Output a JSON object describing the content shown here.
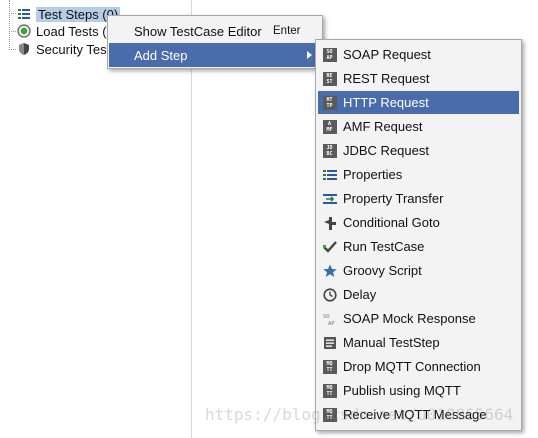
{
  "tree": {
    "items": [
      {
        "label": "Test Steps (0)",
        "icon": "list-icon",
        "selected": true
      },
      {
        "label": "Load Tests (",
        "icon": "gauge-icon",
        "selected": false
      },
      {
        "label": "Security Tes",
        "icon": "shield-icon",
        "selected": false
      }
    ]
  },
  "context_menu": {
    "items": [
      {
        "label": "Show TestCase Editor",
        "accelerator": "Enter"
      },
      {
        "label": "Add Step",
        "has_submenu": true
      }
    ]
  },
  "submenu": {
    "items": [
      {
        "label": "SOAP Request",
        "icon": "soap-request-icon",
        "tile": "SO AP"
      },
      {
        "label": "REST Request",
        "icon": "rest-request-icon",
        "tile": "RE ST"
      },
      {
        "label": "HTTP Request",
        "icon": "http-request-icon",
        "tile": "HT TP",
        "highlighted": true
      },
      {
        "label": "AMF Request",
        "icon": "amf-request-icon",
        "tile": "A MF"
      },
      {
        "label": "JDBC Request",
        "icon": "jdbc-request-icon",
        "tile": "JD BC"
      },
      {
        "label": "Properties",
        "icon": "properties-icon"
      },
      {
        "label": "Property Transfer",
        "icon": "property-transfer-icon"
      },
      {
        "label": "Conditional Goto",
        "icon": "conditional-goto-icon"
      },
      {
        "label": "Run TestCase",
        "icon": "run-testcase-icon"
      },
      {
        "label": "Groovy Script",
        "icon": "groovy-script-icon"
      },
      {
        "label": "Delay",
        "icon": "delay-icon"
      },
      {
        "label": "SOAP Mock Response",
        "icon": "soap-mock-response-icon"
      },
      {
        "label": "Manual TestStep",
        "icon": "manual-teststep-icon"
      },
      {
        "label": "Drop MQTT Connection",
        "icon": "drop-mqtt-icon",
        "tile": "MQ TT"
      },
      {
        "label": "Publish using MQTT",
        "icon": "publish-mqtt-icon",
        "tile": "MQ TT"
      },
      {
        "label": "Receive MQTT Message",
        "icon": "receive-mqtt-icon",
        "tile": "MQ TT"
      }
    ]
  },
  "watermark": "https://blog.csdn.net/u010865664",
  "colors": {
    "menu_highlight": "#4a6cab",
    "tree_selection": "#b6cde8",
    "menu_background": "#f3f3f3"
  }
}
